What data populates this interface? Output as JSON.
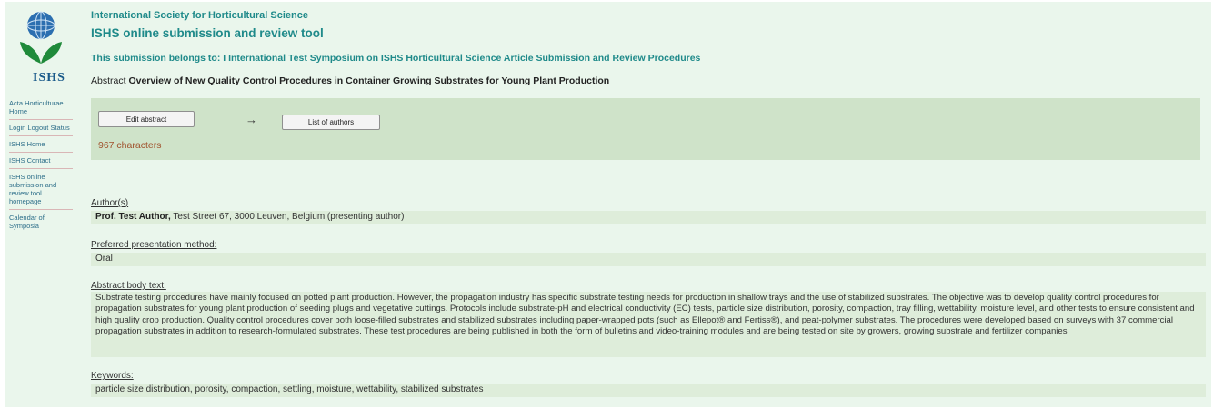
{
  "sidebar": {
    "logo_text": "ISHS",
    "items": [
      {
        "label": "Acta Horticulturae Home"
      },
      {
        "label": "Login Logout Status"
      },
      {
        "label": "ISHS Home"
      },
      {
        "label": "ISHS Contact"
      },
      {
        "label": "ISHS online submission and review tool homepage"
      },
      {
        "label": "Calendar of Symposia"
      }
    ]
  },
  "header": {
    "org_name": "International Society for Horticultural Science",
    "tool_name": "ISHS online submission and review tool",
    "belongs_to": "This submission belongs to: I International Test Symposium on ISHS Horticultural Science Article Submission and Review Procedures",
    "abstract_prefix": "Abstract",
    "abstract_title": "Overview of New Quality Control Procedures in Container Growing Substrates for Young Plant Production"
  },
  "actions": {
    "edit_label": "Edit abstract",
    "arrow": "→",
    "authors_label": "List of authors",
    "char_count": "967 characters"
  },
  "sections": {
    "authors": {
      "label": "Author(s)",
      "name": "Prof. Test Author,",
      "details": " Test Street 67, 3000 Leuven, Belgium (presenting author)"
    },
    "method": {
      "label": "Preferred presentation method:",
      "value": "Oral"
    },
    "body": {
      "label": "Abstract body text:",
      "value": "Substrate testing procedures have mainly focused on potted plant production. However, the propagation industry has specific substrate testing needs for production in shallow trays and the use of stabilized substrates. The objective was to develop quality control procedures for propagation substrates for young plant production of seeding plugs and vegetative cuttings. Protocols include substrate-pH and electrical conductivity (EC) tests, particle size distribution, porosity, compaction, tray filling, wettability, moisture level, and other tests to ensure consistent and high quality crop production. Quality control procedures cover both loose-filled substrates and stabilized substrates including paper-wrapped pots (such as Ellepot® and Fertiss®), and peat-polymer substrates. The procedures were developed based on surveys with 37 commercial propagation substrates in addition to research-formulated substrates. These test procedures are being published in both the form of bulletins and video-training modules and are being tested on site by growers, growing substrate and fertilizer companies"
    },
    "keywords": {
      "label": "Keywords:",
      "value": "particle size distribution, porosity, compaction, settling, moisture, wettability, stabilized substrates"
    }
  },
  "colors": {
    "page_bg": "#eaf6ec",
    "action_bar": "#cfe3c9",
    "section_bg": "#deedda",
    "accent_teal": "#1f8a8a",
    "char_count": "#a0522d"
  }
}
